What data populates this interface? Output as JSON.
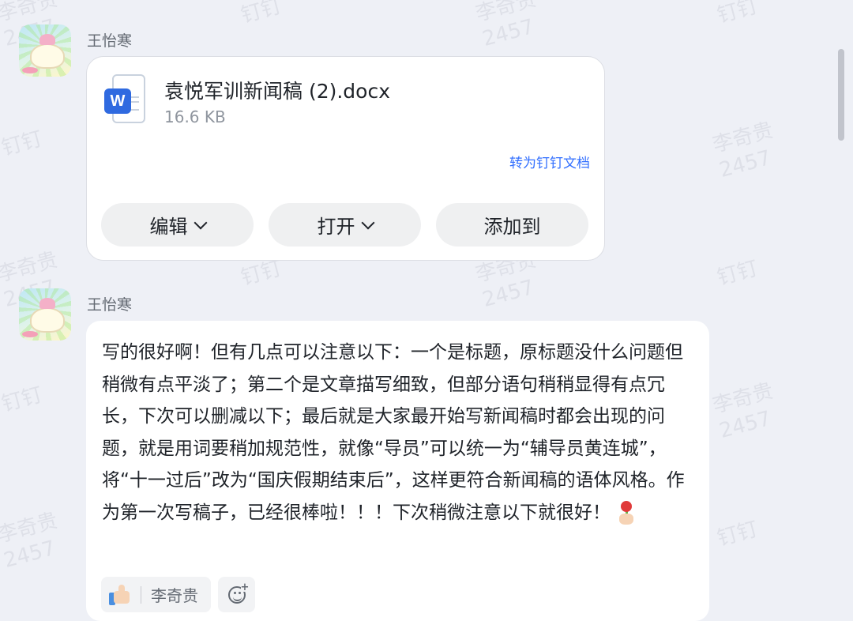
{
  "watermark": {
    "name": "李奇贵",
    "id": "2457",
    "app": "钉钉"
  },
  "messages": [
    {
      "sender": "王怡寒",
      "type": "file",
      "file": {
        "icon": "word-doc-icon",
        "name": "袁悦军训新闻稿 (2).docx",
        "size": "16.6 KB",
        "convert_link": "转为钉钉文档",
        "actions": [
          {
            "label": "编辑",
            "dropdown": true
          },
          {
            "label": "打开",
            "dropdown": true
          },
          {
            "label": "添加到",
            "dropdown": false
          }
        ]
      }
    },
    {
      "sender": "王怡寒",
      "type": "text",
      "text": "写的很好啊！但有几点可以注意以下：一个是标题，原标题没什么问题但稍微有点平淡了；第二个是文章描写细致，但部分语句稍稍显得有点冗长，下次可以删减以下；最后就是大家最开始写新闻稿时都会出现的问题，就是用词要稍加规范性，就像“导员”可以统一为“辅导员黄连城”，将“十一过后”改为“国庆假期结束后”，这样更符合新闻稿的语体风格。作为第一次写稿子，已经很棒啦！！！下次稍微注意以下就很好！",
      "emoji": "flower-in-hand-emoji",
      "reactions": [
        {
          "icon": "thumbs-up-icon",
          "user": "李奇贵"
        }
      ]
    }
  ],
  "colors": {
    "link": "#3370ff",
    "background": "#eef0f6",
    "card": "#ffffff",
    "button": "#eff0f1"
  }
}
